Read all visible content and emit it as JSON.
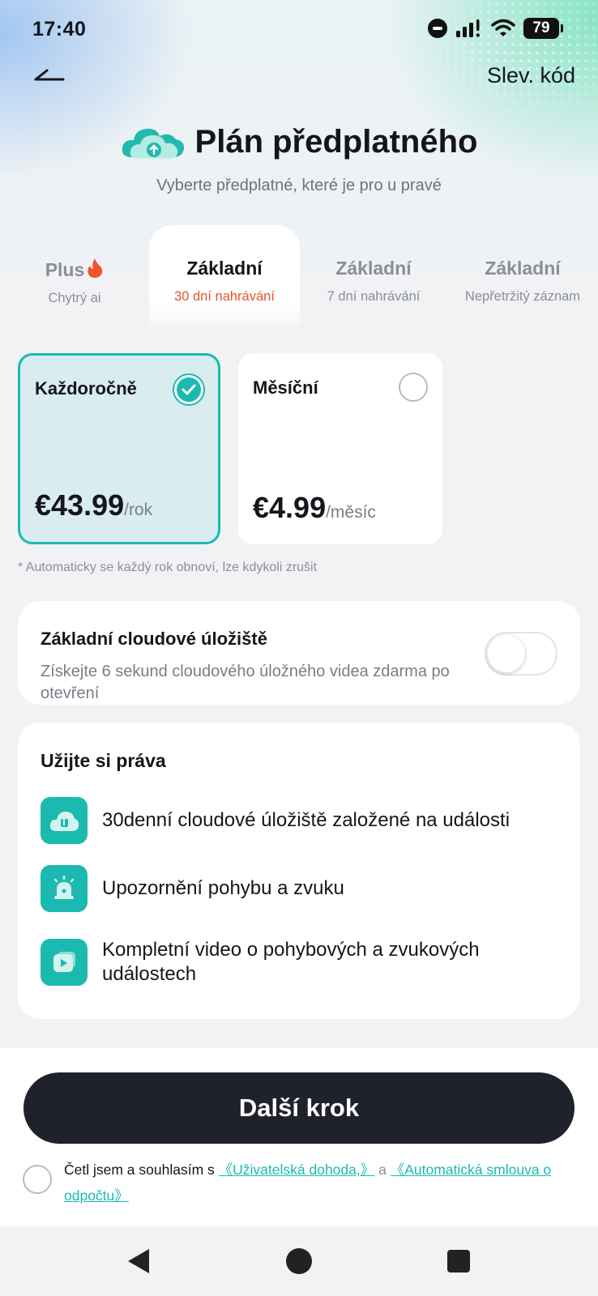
{
  "status_bar": {
    "time": "17:40",
    "battery": "79"
  },
  "header": {
    "promo_label": "Slev. kód",
    "title": "Plán předplatného",
    "subtitle": "Vyberte předplatné, které je pro u pravé"
  },
  "tabs": [
    {
      "title": "Plus",
      "subtitle": "Chytrý ai",
      "active": false
    },
    {
      "title": "Základní",
      "subtitle": "30 dní nahrávání",
      "active": true
    },
    {
      "title": "Základní",
      "subtitle": "7 dní nahrávání",
      "active": false
    },
    {
      "title": "Základní",
      "subtitle": "Nepřetržitý záznam",
      "active": false
    }
  ],
  "plans": [
    {
      "name": "Každoročně",
      "price": "€43.99",
      "period": "/rok",
      "selected": true
    },
    {
      "name": "Měsíční",
      "price": "€4.99",
      "period": "/měsíc",
      "selected": false
    }
  ],
  "renew_note": "* Automaticky se každý rok obnoví, lze kdykoli zrušit",
  "storage": {
    "title": "Základní cloudové úložiště",
    "description": "Získejte 6 sekund cloudového úložného videa zdarma po otevření",
    "enabled": false
  },
  "rights": {
    "title": "Užijte si práva",
    "items": [
      {
        "icon": "cloud-storage-icon",
        "label": "30denní cloudové úložiště založené na události"
      },
      {
        "icon": "alarm-icon",
        "label": "Upozornění pohybu a zvuku"
      },
      {
        "icon": "video-play-icon",
        "label": "Kompletní video o pohybových a zvukových událostech"
      }
    ]
  },
  "footer": {
    "next_button": "Další krok",
    "agree_prefix": "Četl jsem a souhlasím s",
    "link_user_agreement": "《Uživatelská dohoda,》",
    "conjunction": "a",
    "link_auto_debit": "《Automatická smlouva o odpočtu》"
  },
  "colors": {
    "accent": "#1bbab0",
    "highlight": "#e8542d",
    "button_dark": "#20222b"
  }
}
